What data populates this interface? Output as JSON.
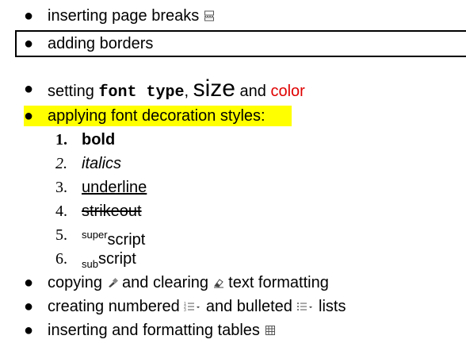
{
  "colors": {
    "highlight": "#ffff00",
    "red": "#e00000",
    "border": "#000000"
  },
  "items": {
    "page_breaks": "inserting page breaks",
    "borders": "adding borders",
    "font_pre": "setting ",
    "font_type": "font type",
    "comma": ", ",
    "size": "size",
    "and": " and ",
    "color": "color",
    "decoration": "applying font decoration styles:",
    "copying_a": "copying ",
    "copying_b": " and clearing ",
    "copying_c": " text formatting",
    "numbered_a": "creating numbered ",
    "numbered_b": " and bulleted ",
    "numbered_c": " lists",
    "tables": "inserting and formatting tables "
  },
  "styles": [
    {
      "num": "1.",
      "label": "bold"
    },
    {
      "num": "2.",
      "label": "italics"
    },
    {
      "num": "3.",
      "label": "underline"
    },
    {
      "num": "4.",
      "label": "strikeout"
    },
    {
      "num": "5.",
      "sup": "super",
      "label": "script"
    },
    {
      "num": "6.",
      "sub": "sub",
      "label": "script"
    }
  ],
  "icons": [
    "page-break-icon",
    "format-painter-icon",
    "eraser-icon",
    "numbered-list-icon",
    "bulleted-list-icon",
    "dropdown-arrow-icon",
    "table-icon"
  ]
}
